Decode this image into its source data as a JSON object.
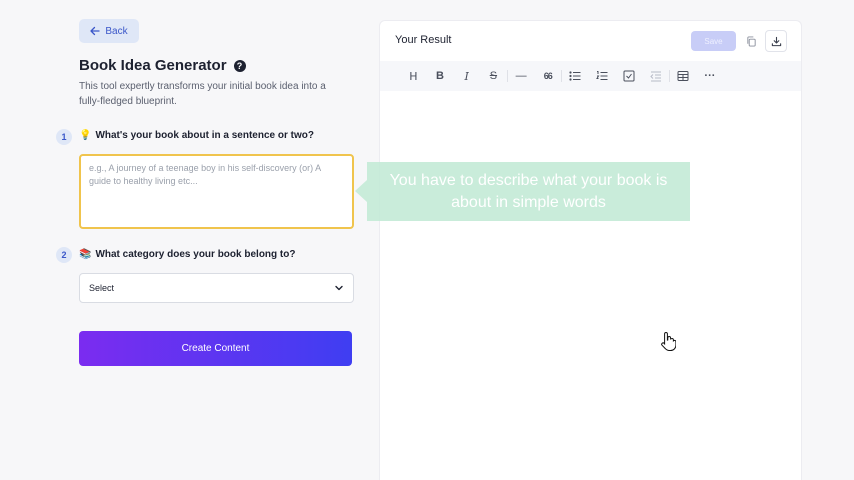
{
  "form": {
    "back_label": "Back",
    "title": "Book Idea Generator",
    "subtitle": "This tool expertly transforms your initial book idea into a fully-fledged blueprint.",
    "step1": {
      "number": "1",
      "icon": "lightbulb-icon",
      "label": "What's your book about in a sentence or two?",
      "placeholder": "e.g., A journey of a teenage boy in his self-discovery (or) A guide to healthy living etc...",
      "value": ""
    },
    "step2": {
      "number": "2",
      "icon": "books-icon",
      "label": "What category does your book belong to?",
      "selected": "Select"
    },
    "submit_label": "Create Content"
  },
  "result": {
    "title": "Your Result",
    "save_label": "Save",
    "toolbar": [
      {
        "name": "heading",
        "glyph": "H"
      },
      {
        "name": "bold",
        "glyph": "B"
      },
      {
        "name": "italic",
        "glyph": "I"
      },
      {
        "name": "strikethrough",
        "glyph": "S"
      },
      {
        "name": "horizontal-rule",
        "glyph": "—"
      },
      {
        "name": "blockquote",
        "glyph": "66"
      },
      {
        "name": "bullet-list",
        "glyph": ""
      },
      {
        "name": "ordered-list",
        "glyph": ""
      },
      {
        "name": "task-list",
        "glyph": ""
      },
      {
        "name": "outdent",
        "glyph": ""
      },
      {
        "name": "table",
        "glyph": ""
      },
      {
        "name": "more",
        "glyph": "···"
      }
    ]
  },
  "tooltip": {
    "text": "You have to describe what your book is about in simple words"
  },
  "colors": {
    "accent": "#3b57c9",
    "button_gradient_start": "#7b2cf0",
    "button_gradient_end": "#3f3ef2",
    "focus_border": "#f0c44d",
    "tooltip_bg": "#c3ead6"
  }
}
